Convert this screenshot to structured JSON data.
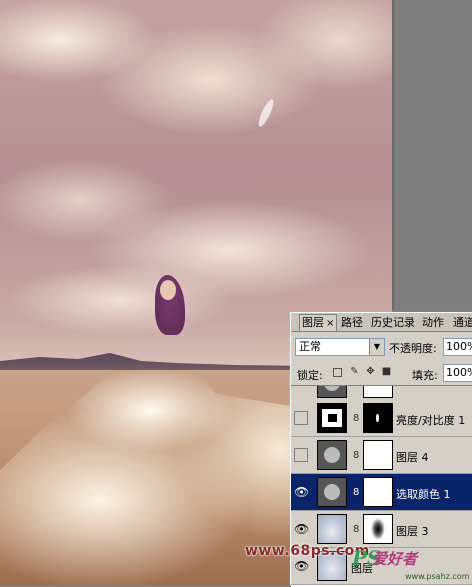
{
  "panel": {
    "tabs": [
      {
        "label": "图层",
        "active": true,
        "close": "×"
      },
      {
        "label": "路径",
        "active": false
      },
      {
        "label": "历史记录",
        "active": false
      },
      {
        "label": "动作",
        "active": false
      },
      {
        "label": "通道",
        "active": false
      }
    ],
    "blend_mode": "正常",
    "opacity_label": "不透明度:",
    "opacity_value": "100%",
    "lock_label": "锁定:",
    "fill_label": "填充:",
    "fill_value": "100%"
  },
  "layers": [
    {
      "name": "亮度/对比度 1",
      "visible": false,
      "selected": false,
      "thumb": "brightness-contrast",
      "mask": "black-with-mark"
    },
    {
      "name": "图层 4",
      "visible": false,
      "selected": false,
      "thumb": "adjustment",
      "mask": "white"
    },
    {
      "name": "选取颜色 1",
      "visible": true,
      "selected": true,
      "thumb": "adjustment",
      "mask": "white"
    },
    {
      "name": "图层 3",
      "visible": true,
      "selected": false,
      "thumb": "photo",
      "mask": "blob"
    },
    {
      "name": "图层",
      "visible": true,
      "selected": false,
      "thumb": "photo",
      "mask": "none"
    }
  ],
  "icons": {
    "eye": "eye-icon",
    "chain": "chain-link-icon",
    "lock_transparent": "lock-transparency-icon",
    "lock_paint": "brush-icon",
    "lock_move": "move-arrows-icon",
    "lock_all": "padlock-icon"
  },
  "watermarks": {
    "left": "www.68ps.com",
    "logo": "PS",
    "right": "爱好者",
    "right_url": "www.psahz.com"
  },
  "colors": {
    "selected_row": "#0a246a",
    "panel_bg": "#d4d0c8",
    "watermark_left": "#8a2a2a",
    "watermark_right": "#b33c7a"
  }
}
